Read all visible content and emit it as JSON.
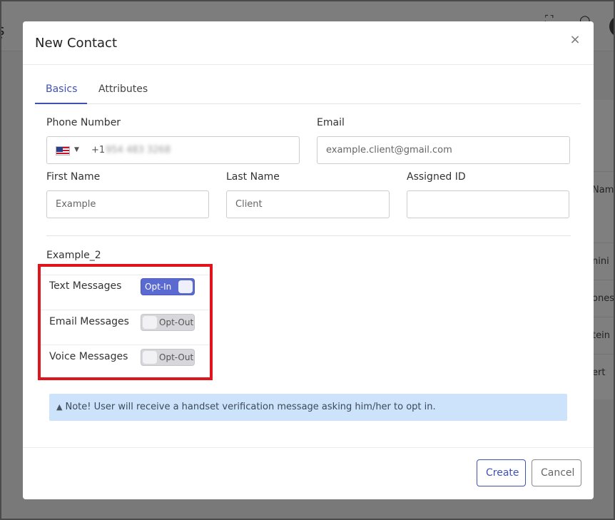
{
  "background": {
    "rows": [
      "Name",
      "nini",
      "ones",
      "tein",
      "ert"
    ]
  },
  "modal": {
    "title": "New Contact",
    "close_symbol": "×",
    "tabs": [
      {
        "label": "Basics",
        "active": true
      },
      {
        "label": "Attributes",
        "active": false
      }
    ],
    "fields": {
      "phone": {
        "label": "Phone Number",
        "country_code": "+1",
        "number": "954 483 3268"
      },
      "email": {
        "label": "Email",
        "value": "",
        "placeholder": "example.client@gmail.com"
      },
      "first_name": {
        "label": "First Name",
        "value": "",
        "placeholder": "Example"
      },
      "last_name": {
        "label": "Last Name",
        "value": "",
        "placeholder": "Client"
      },
      "assigned_id": {
        "label": "Assigned ID",
        "value": "",
        "placeholder": ""
      }
    },
    "group": {
      "title": "Example_2",
      "items": [
        {
          "label": "Text Messages",
          "state": "on",
          "toggle_text": "Opt-In"
        },
        {
          "label": "Email Messages",
          "state": "off",
          "toggle_text": "Opt-Out"
        },
        {
          "label": "Voice Messages",
          "state": "off",
          "toggle_text": "Opt-Out"
        }
      ]
    },
    "note": {
      "icon": "warning-icon",
      "text": "Note! User will receive a handset verification message asking him/her to opt in."
    },
    "buttons": {
      "create": "Create",
      "cancel": "Cancel"
    }
  },
  "colors": {
    "accent": "#3f51b5",
    "toggle_on": "#5b6ad0",
    "highlight": "#e0141c",
    "note_bg": "#cce3fb"
  }
}
